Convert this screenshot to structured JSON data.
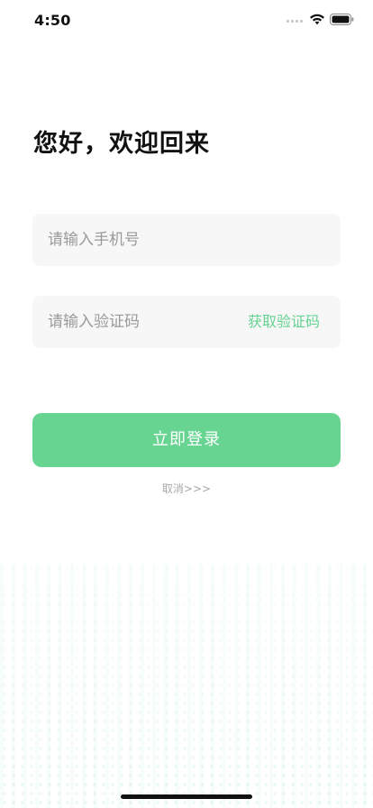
{
  "status_bar": {
    "time": "4:50",
    "icons": [
      "signal-icon",
      "wifi-icon",
      "battery-icon"
    ]
  },
  "greeting": "您好，欢迎回来",
  "phone_field": {
    "value": "",
    "placeholder": "请输入手机号"
  },
  "code_field": {
    "value": "",
    "placeholder": "请输入验证码",
    "get_code_label": "获取验证码"
  },
  "login_button": {
    "label": "立即登录"
  },
  "cancel_link": "取消>>>",
  "colors": {
    "accent": "#68d492",
    "accent_text": "#66d392",
    "field_bg": "#f7f7f7",
    "placeholder": "#9a9a9a",
    "muted": "#a8a8a8"
  }
}
